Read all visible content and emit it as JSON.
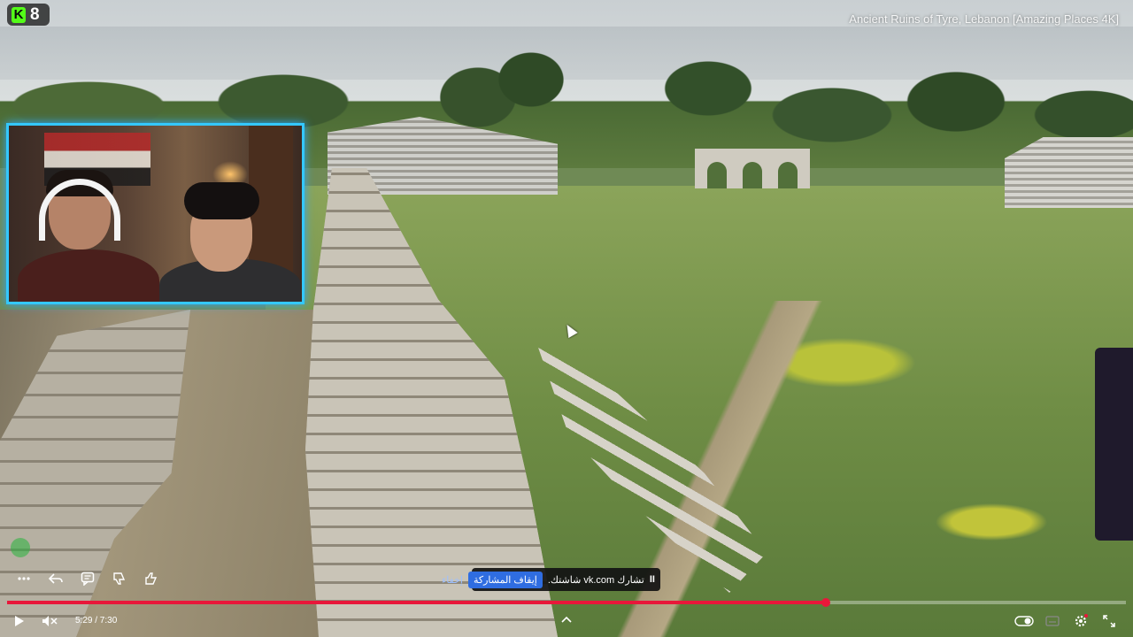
{
  "overlay": {
    "kick_number": "8",
    "video_title": "Ancient Ruins of Tyre, Lebanon  [Amazing Places 4K]"
  },
  "share_banner": {
    "pause_indicator": "II",
    "message": "تشارك vk.com شاشتك.",
    "stop_label": "إيقاف المشاركة",
    "hide_label": "إخفاء"
  },
  "player": {
    "current_time": "5:29",
    "duration": "7:30",
    "time_display": "5:29 / 7:30",
    "progress_fraction": 0.732,
    "accent_color": "#e8173a"
  },
  "icons": {
    "toolbar": [
      "more-icon",
      "reply-icon",
      "comment-icon",
      "dislike-icon",
      "like-icon"
    ],
    "controls_left": [
      "play-icon",
      "mute-icon"
    ],
    "controls_right": [
      "toggle-icon",
      "subtitles-icon",
      "settings-icon",
      "fullscreen-icon"
    ]
  },
  "colors": {
    "kick_brand": "#53fc18",
    "webcam_border": "#34c8ff",
    "stop_button": "#2f6de1"
  }
}
